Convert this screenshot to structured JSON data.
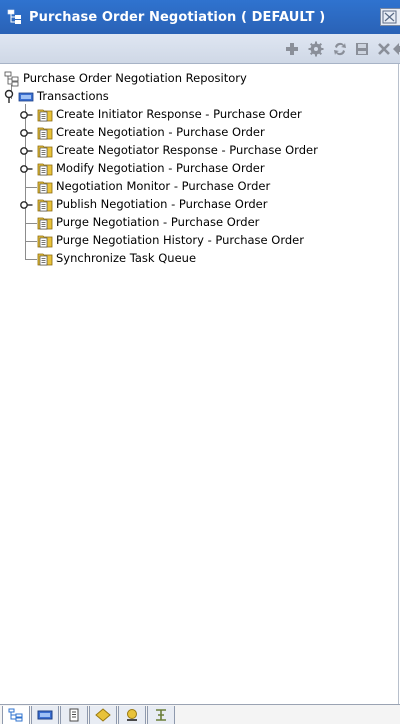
{
  "window": {
    "title": "Purchase Order Negotiation ( DEFAULT )"
  },
  "toolbar": {
    "icons": [
      "add-icon",
      "gear-icon",
      "refresh-icon",
      "save-icon",
      "delete-icon",
      "export-icon"
    ]
  },
  "tree": {
    "root_label": "Purchase Order Negotiation Repository",
    "group_label": "Transactions",
    "items": [
      {
        "label": "Create Initiator Response - Purchase Order",
        "expandable": true
      },
      {
        "label": "Create Negotiation - Purchase Order",
        "expandable": true
      },
      {
        "label": "Create Negotiator Response - Purchase Order",
        "expandable": true
      },
      {
        "label": "Modify Negotiation - Purchase Order",
        "expandable": true
      },
      {
        "label": "Negotiation Monitor - Purchase Order",
        "expandable": false
      },
      {
        "label": "Publish Negotiation - Purchase Order",
        "expandable": true
      },
      {
        "label": "Purge Negotiation - Purchase Order",
        "expandable": false
      },
      {
        "label": "Purge Negotiation History - Purchase Order",
        "expandable": false
      },
      {
        "label": "Synchronize Task Queue",
        "expandable": false
      }
    ]
  },
  "bottom_tabs": [
    "tree-view-icon",
    "transaction-icon",
    "document-icon",
    "rule-icon",
    "monitor-icon",
    "hierarchy-icon"
  ],
  "colors": {
    "titlebar": "#2a62b6",
    "folder": "#e8c23a",
    "toolbar_icon": "#8a8f99"
  }
}
